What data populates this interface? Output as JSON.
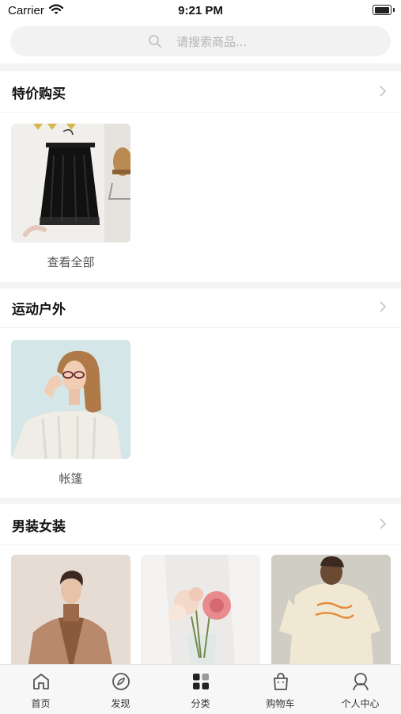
{
  "status_bar": {
    "carrier": "Carrier",
    "time": "9:21 PM"
  },
  "search": {
    "placeholder": "请搜索商品..."
  },
  "sections": [
    {
      "title": "特价购买",
      "items": [
        {
          "label": "查看全部",
          "image": "black-skirt-on-hanger"
        }
      ]
    },
    {
      "title": "运动户外",
      "items": [
        {
          "label": "帐篷",
          "image": "woman-cream-sweater"
        }
      ]
    },
    {
      "title": "男装女装",
      "items": [
        {
          "label": "",
          "image": "man-tan-coat"
        },
        {
          "label": "",
          "image": "flowers-in-vase"
        },
        {
          "label": "",
          "image": "man-cream-tshirt"
        }
      ]
    }
  ],
  "tab_bar": {
    "tabs": [
      {
        "label": "首页",
        "icon": "home-icon",
        "active": false
      },
      {
        "label": "发现",
        "icon": "compass-icon",
        "active": false
      },
      {
        "label": "分类",
        "icon": "grid-icon",
        "active": true
      },
      {
        "label": "购物车",
        "icon": "shopping-bag-icon",
        "active": false
      },
      {
        "label": "个人中心",
        "icon": "profile-icon",
        "active": false
      }
    ]
  },
  "colors": {
    "background": "#ffffff",
    "section_gap": "#f4f4f4",
    "search_bg": "#f2f2f2",
    "tab_bar_bg": "#f7f7f7",
    "active_icon": "#222222",
    "inactive_icon": "#555555"
  }
}
